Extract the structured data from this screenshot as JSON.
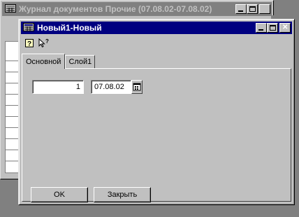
{
  "background_window": {
    "title": "Журнал документов Прочие (07.08.02-07.08.02)"
  },
  "dialog": {
    "title": "Новый1-Новый",
    "toolbar": {
      "help_icon": "help-question-icon",
      "whats_this_icon": "pointer-question-icon"
    },
    "tabs": [
      {
        "label": "Основной",
        "active": true
      },
      {
        "label": "Слой1",
        "active": false
      }
    ],
    "fields": {
      "number": "1",
      "date": "07.08.02"
    },
    "buttons": {
      "ok": "OK",
      "close": "Закрыть"
    }
  },
  "colors": {
    "active_title": "#000080",
    "inactive_title": "#808080",
    "face": "#c0c0c0"
  }
}
